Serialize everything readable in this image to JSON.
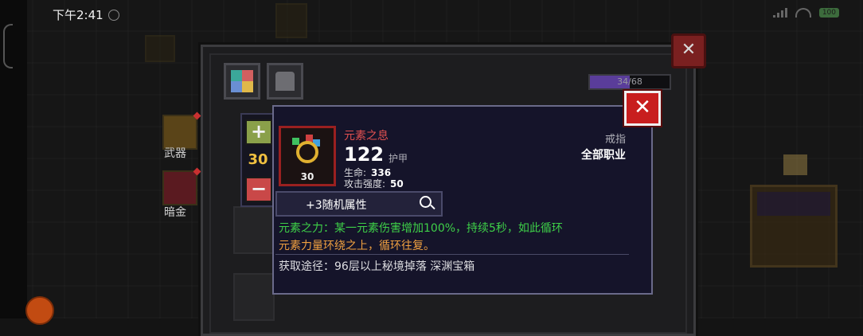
{
  "status_bar": {
    "time": "下午2:41",
    "battery": "100"
  },
  "inventory": {
    "capacity_text": "34/68",
    "capacity_fraction": 0.5,
    "close_glyph": "✕",
    "side_slots": {
      "weapon_label": "武器",
      "accessory_label": "暗金"
    }
  },
  "quantity": {
    "plus_glyph": "+",
    "value": "30",
    "minus_glyph": "−"
  },
  "tooltip": {
    "close_glyph": "✕",
    "item_level": "30",
    "name": "元素之息",
    "power": "122",
    "power_label": "护甲",
    "stats": [
      {
        "label": "生命:",
        "value": "336"
      },
      {
        "label": "攻击强度:",
        "value": "50"
      }
    ],
    "item_type": "戒指",
    "item_class": "全部职业",
    "affix_label": "+3随机属性",
    "effect_green": "元素之力：",
    "effect_line1_rest": "某一元素伤害增加100%，持续5秒，如此循环",
    "effect_line2": "元素力量环绕之上，循环往复。",
    "source": "获取途径：96层以上秘境掉落 深渊宝箱"
  }
}
